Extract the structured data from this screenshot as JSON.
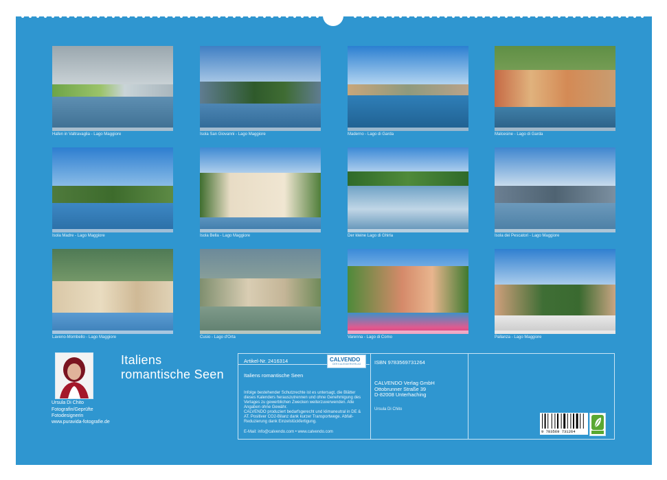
{
  "captions": [
    "Hafen in Valtravaglia - Lago Maggiore",
    "Isola San Giovanni - Lago Maggiore",
    "Maderno - Lago di Garda",
    "Malcesine - Lago di Garda",
    "Isola Madre - Lago Maggiore",
    "Isola Bella - Lago Maggiore",
    "Der kleine Lago di Ghirla",
    "Isola dei Pescatori - Lago Maggiore",
    "Laveno-Mombello - Lago Maggiore",
    "Cusio - Lago d'Orta",
    "Varenna - Lago di Como",
    "Pallanza - Lago Maggiore"
  ],
  "author": {
    "name": "Ursula Di Chito",
    "line1": "Fotografin/Geprüfte",
    "line2": "Fotodesignerin",
    "line3": "www.puravida-fotografie.de"
  },
  "title": {
    "line1": "Italiens",
    "line2": "romantische Seen"
  },
  "info": {
    "article_label": "Artikel-Nr. 2416314",
    "calvendo_logo": "CALVENDO",
    "calvendo_sub": "DER KALENDERVERLAG",
    "product_title": "Italiens romantische Seen",
    "legal1": "Infolge bestehender Schutzrechte ist es untersagt, die Blätter dieses Kalenders herauszutrennen und ohne Genehmigung des Verlages zu gewerblichen Zwecken weiterzuverwenden. Alle Angaben ohne Gewähr.",
    "legal2": "CALVENDO produziert bedarfsgerecht und klimaneutral in DE & AT. Positiver CO2-Bilanz dank kurzer Transportwege. Abfall-Reduzierung dank Einzelstückfertigung.",
    "contact": "E-Mail: info@calvendo.com • www.calvendo.com",
    "isbn": "ISBN 9783569731264",
    "publisher1": "CALVENDO Verlag GmbH",
    "publisher2": "Ottobrunner Straße 39",
    "publisher3": "D-82008 Unterhaching",
    "author_small": "Ursula Di Chito",
    "barcode_number": "9 783569 731264"
  }
}
